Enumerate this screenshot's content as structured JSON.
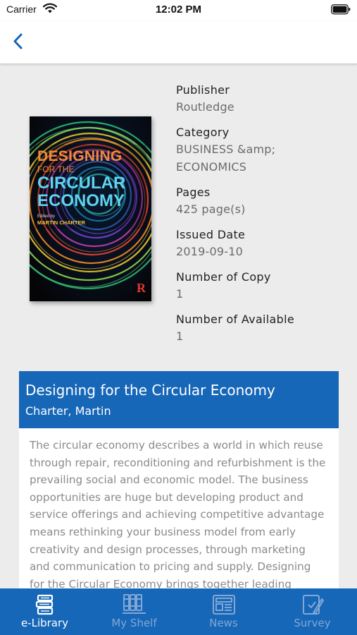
{
  "status_bar": {
    "carrier": "Carrier",
    "time": "12:02 PM"
  },
  "book": {
    "cover": {
      "title_line1": "DESIGNING",
      "title_line2": "FOR THE",
      "title_line3": "CIRCULAR",
      "title_line4": "ECONOMY",
      "edited_by": "Edited by",
      "editor": "MARTIN CHARTER",
      "publisher_mark": "R"
    },
    "details": [
      {
        "label": "Publisher",
        "value": "Routledge"
      },
      {
        "label": "Category",
        "value": "BUSINESS &amp;\nECONOMICS"
      },
      {
        "label": "Pages",
        "value": "425 page(s)"
      },
      {
        "label": "Issued Date",
        "value": "2019-09-10"
      },
      {
        "label": "Number of Copy",
        "value": "1"
      },
      {
        "label": "Number of Available",
        "value": "1"
      }
    ],
    "title": "Designing for the Circular Economy",
    "author": "Charter, Martin",
    "description": "The circular economy describes a world in which reuse through repair, reconditioning and refurbishment is the prevailing social and economic model. The business opportunities are huge but developing product and service offerings and achieving competitive advantage means rethinking your business model from early creativity and design processes, through marketing and communication to pricing and supply. Designing for the Circular Economy brings together leading experts"
  },
  "tabs": [
    {
      "label": "e-Library",
      "icon": "books-stack-icon",
      "active": true
    },
    {
      "label": "My Shelf",
      "icon": "bookshelf-icon",
      "active": false
    },
    {
      "label": "News",
      "icon": "newspaper-icon",
      "active": false
    },
    {
      "label": "Survey",
      "icon": "survey-pencil-icon",
      "active": false
    }
  ],
  "colors": {
    "primary": "#1767b8",
    "tab_inactive": "#82a7d4",
    "background": "#ececec"
  }
}
